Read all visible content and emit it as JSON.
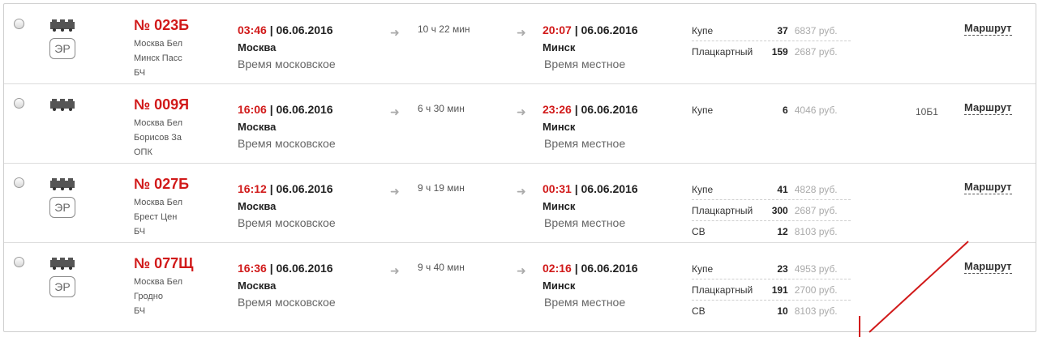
{
  "radio_label": "",
  "trains": [
    {
      "number": "№ 023Б",
      "route": [
        "Москва Бел",
        "Минск Пасс",
        "БЧ"
      ],
      "badge": "ЭР",
      "dep_time": "03:46",
      "dep_date": "06.06.2016",
      "dep_city": "Москва",
      "dep_note": "Время московское",
      "duration": "10 ч 22 мин",
      "arr_time": "20:07",
      "arr_date": "06.06.2016",
      "arr_city": "Минск",
      "arr_note": "Время местное",
      "seats": [
        {
          "type": "Купе",
          "count": "37",
          "price": "6837 руб."
        },
        {
          "type": "Плацкартный",
          "count": "159",
          "price": "2687 руб."
        }
      ],
      "extra": "",
      "link": "Маршрут"
    },
    {
      "number": "№ 009Я",
      "route": [
        "Москва Бел",
        "Борисов За",
        "ОПК"
      ],
      "badge": "",
      "dep_time": "16:06",
      "dep_date": "06.06.2016",
      "dep_city": "Москва",
      "dep_note": "Время московское",
      "duration": "6 ч 30 мин",
      "arr_time": "23:26",
      "arr_date": "06.06.2016",
      "arr_city": "Минск",
      "arr_note": "Время местное",
      "seats": [
        {
          "type": "Купе",
          "count": "6",
          "price": "4046 руб."
        }
      ],
      "extra": "10Б1",
      "link": "Маршрут"
    },
    {
      "number": "№ 027Б",
      "route": [
        "Москва Бел",
        "Брест Цен",
        "БЧ"
      ],
      "badge": "ЭР",
      "dep_time": "16:12",
      "dep_date": "06.06.2016",
      "dep_city": "Москва",
      "dep_note": "Время московское",
      "duration": "9 ч 19 мин",
      "arr_time": "00:31",
      "arr_date": "06.06.2016",
      "arr_city": "Минск",
      "arr_note": "Время местное",
      "seats": [
        {
          "type": "Купе",
          "count": "41",
          "price": "4828 руб."
        },
        {
          "type": "Плацкартный",
          "count": "300",
          "price": "2687 руб."
        },
        {
          "type": "СВ",
          "count": "12",
          "price": "8103 руб."
        }
      ],
      "extra": "",
      "link": "Маршрут"
    },
    {
      "number": "№ 077Щ",
      "route": [
        "Москва Бел",
        "Гродно",
        "БЧ"
      ],
      "badge": "ЭР",
      "dep_time": "16:36",
      "dep_date": "06.06.2016",
      "dep_city": "Москва",
      "dep_note": "Время московское",
      "duration": "9 ч 40 мин",
      "arr_time": "02:16",
      "arr_date": "06.06.2016",
      "arr_city": "Минск",
      "arr_note": "Время местное",
      "seats": [
        {
          "type": "Купе",
          "count": "23",
          "price": "4953 руб."
        },
        {
          "type": "Плацкартный",
          "count": "191",
          "price": "2700 руб."
        },
        {
          "type": "СВ",
          "count": "10",
          "price": "8103 руб."
        }
      ],
      "extra": "",
      "link": "Маршрут"
    }
  ],
  "separator": " | ",
  "arrow_glyph": "➜",
  "colors": {
    "accent": "#d11a1a",
    "annotation": "#d11a1a"
  }
}
